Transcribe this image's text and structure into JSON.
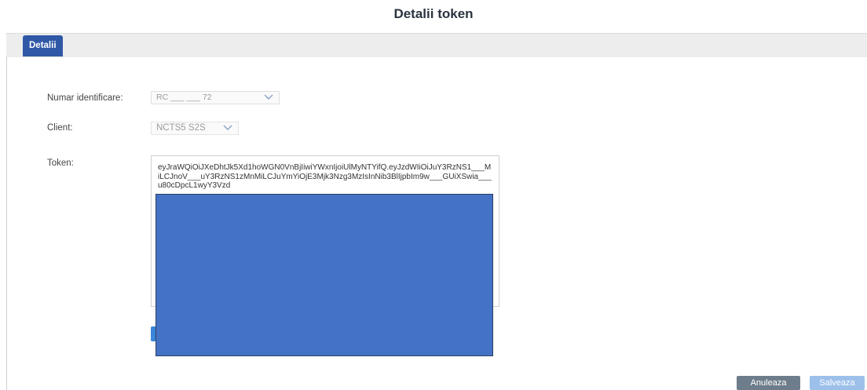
{
  "dialog": {
    "title": "Detalii token"
  },
  "tabs": [
    {
      "label": "Detalii"
    }
  ],
  "form": {
    "identifier": {
      "label": "Numar identificare:",
      "value": "RC ___ ___ 72"
    },
    "client": {
      "label": "Client:",
      "value": "NCTS5 S2S"
    },
    "token": {
      "label": "Token:",
      "value": "eyJraWQiOiJXeDhtJk5Xd1hoWGN0VnBjIiwiYWxnIjoiUlMyNTYifQ.eyJzdWIiOiJuY3RzNS1___MiLCJnoV___uY3RzNS1zMnMiLCJuYmYiOjE3Mjk3Nzg3MzIsInNib3BlIjpbIm9w___GUiXSwia___u80cDpcL1wyY3Vzd"
    }
  },
  "footer": {
    "cancel_label": "Anuleaza",
    "save_label": "Salveaza"
  },
  "colors": {
    "tab_active": "#2f58a6",
    "mask": "#4472c4",
    "cancel": "#6e7d8b",
    "save": "#9dc0eb"
  }
}
